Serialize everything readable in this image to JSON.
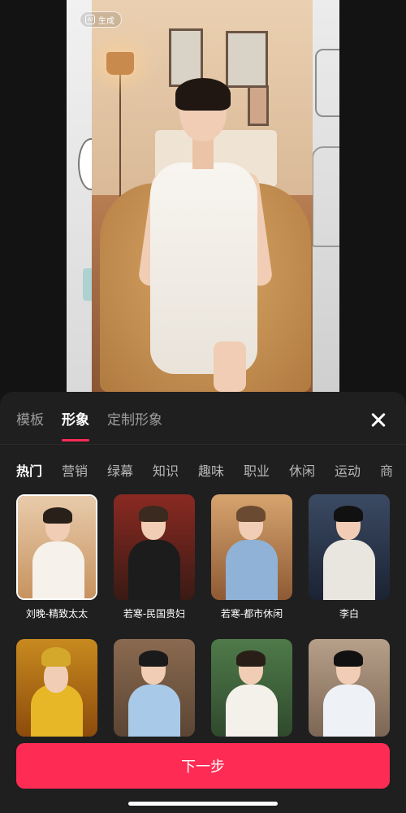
{
  "preview": {
    "ai_badge_icon": "AI",
    "ai_badge_label": "生成"
  },
  "tabs": [
    {
      "label": "模板",
      "active": false
    },
    {
      "label": "形象",
      "active": true
    },
    {
      "label": "定制形象",
      "active": false
    }
  ],
  "categories": [
    {
      "label": "热门",
      "active": true
    },
    {
      "label": "营销",
      "active": false
    },
    {
      "label": "绿幕",
      "active": false
    },
    {
      "label": "知识",
      "active": false
    },
    {
      "label": "趣味",
      "active": false
    },
    {
      "label": "职业",
      "active": false
    },
    {
      "label": "休闲",
      "active": false
    },
    {
      "label": "运动",
      "active": false
    },
    {
      "label": "商",
      "active": false
    }
  ],
  "avatars": [
    {
      "name": "刘晚-精致太太",
      "selected": true
    },
    {
      "name": "若寒-民国贵妇",
      "selected": false
    },
    {
      "name": "若寒-都市休闲",
      "selected": false
    },
    {
      "name": "李白",
      "selected": false
    },
    {
      "name": "",
      "selected": false
    },
    {
      "name": "",
      "selected": false
    },
    {
      "name": "",
      "selected": false
    },
    {
      "name": "",
      "selected": false
    }
  ],
  "cta": {
    "label": "下一步"
  },
  "colors": {
    "accent": "#fe2c55",
    "sheet": "#1f1f1f"
  }
}
